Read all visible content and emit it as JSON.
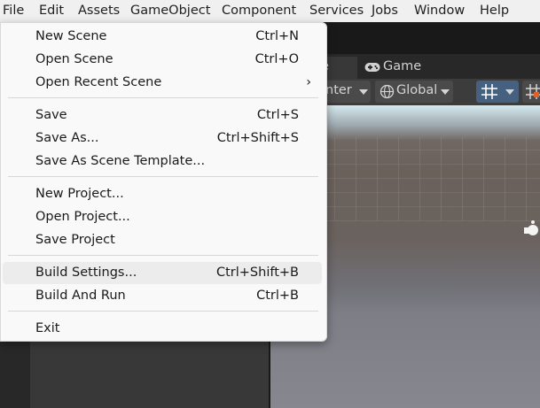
{
  "menubar": {
    "items": [
      "File",
      "Edit",
      "Assets",
      "GameObject",
      "Component",
      "Services",
      "Jobs",
      "Window",
      "Help"
    ]
  },
  "tabs": {
    "scene_partial": "e",
    "game": "Game"
  },
  "scene_toolbar": {
    "pivot_partial": "nter",
    "global": "Global"
  },
  "file_menu": {
    "groups": [
      [
        {
          "label": "New Scene",
          "shortcut": "Ctrl+N"
        },
        {
          "label": "Open Scene",
          "shortcut": "Ctrl+O"
        },
        {
          "label": "Open Recent Scene",
          "submenu_arrow": "›"
        }
      ],
      [
        {
          "label": "Save",
          "shortcut": "Ctrl+S"
        },
        {
          "label": "Save As...",
          "shortcut": "Ctrl+Shift+S"
        },
        {
          "label": "Save As Scene Template..."
        }
      ],
      [
        {
          "label": "New Project..."
        },
        {
          "label": "Open Project..."
        },
        {
          "label": "Save Project"
        }
      ],
      [
        {
          "label": "Build Settings...",
          "shortcut": "Ctrl+Shift+B",
          "highlighted": true
        },
        {
          "label": "Build And Run",
          "shortcut": "Ctrl+B"
        }
      ],
      [
        {
          "label": "Exit"
        }
      ]
    ]
  },
  "colors": {
    "menubar_bg": "#f0f0f0",
    "menu_bg": "#f9f9f9",
    "highlight": "#ececec",
    "editor_dark": "#282828",
    "active_tool": "#46607f"
  }
}
